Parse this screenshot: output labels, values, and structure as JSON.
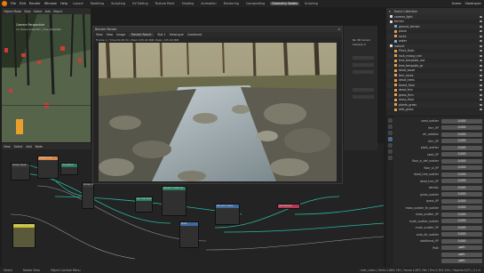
{
  "app": {
    "menus": [
      "File",
      "Edit",
      "Render",
      "Window",
      "Help"
    ],
    "workspaces": [
      "Layout",
      "Modeling",
      "Sculpting",
      "UV Editing",
      "Texture Paint",
      "Shading",
      "Animation",
      "Rendering",
      "Compositing",
      "Geometry Nodes",
      "Scripting"
    ],
    "active_workspace": "Geometry Nodes",
    "scene": "Scene",
    "view_layer": "ViewLayer"
  },
  "viewport": {
    "menu": [
      "Object Mode",
      "View",
      "Select",
      "Add",
      "Object"
    ],
    "view_label": "Camera Perspective",
    "collection_label": "(1) Scene Collection | tree_template"
  },
  "image_editor": {
    "window_title": "Blender Render",
    "menu": [
      "View",
      "View",
      "Image"
    ],
    "image_name": "Render Result",
    "slot": "Slot 1",
    "layer": "ViewLayer",
    "pass": "Combined",
    "info": "Frame:1 | Time:00:28.31 | Mem:225.00 MiB, Peak: 225.00 MiB"
  },
  "node_editor": {
    "menu": [
      "View",
      "Select",
      "Add",
      "Node"
    ],
    "nodes": [
      "Group Input",
      "Object Info",
      "Group Output",
      "Instance on Points",
      "Realize Instances",
      "Math",
      "Random Value",
      "Set Position",
      "Join Geometry",
      "Transform"
    ]
  },
  "side_panel": {
    "items": [
      "No 3D Cursor",
      "Camera Ir"
    ]
  },
  "outliner": {
    "title": "Scene Collection",
    "items": [
      {
        "name": "camera_light",
        "color": "#d9d9d9"
      },
      {
        "name": "terrain",
        "color": "#d9d9d9"
      },
      {
        "name": "ground_terrain",
        "color": "#6fb0e0"
      },
      {
        "name": "plane",
        "color": "#e8a04b"
      },
      {
        "name": "rocks",
        "color": "#e8a04b"
      },
      {
        "name": "water",
        "color": "#6fb0e0"
      },
      {
        "name": "natural",
        "color": "#d9d9d9"
      },
      {
        "name": "Plant_Bush",
        "color": "#e8a04b"
      },
      {
        "name": "rock_mossy_red",
        "color": "#e8a04b"
      },
      {
        "name": "tree_template_red",
        "color": "#e8a04b"
      },
      {
        "name": "tree_template_gr",
        "color": "#e8a04b"
      },
      {
        "name": "dead_wood",
        "color": "#e8a04b"
      },
      {
        "name": "fern_rocks",
        "color": "#e8a04b"
      },
      {
        "name": "dead_trees",
        "color": "#e8a04b"
      },
      {
        "name": "forest_floor",
        "color": "#e8a04b"
      },
      {
        "name": "dead_fern",
        "color": "#e8a04b"
      },
      {
        "name": "grass_firm",
        "color": "#e8a04b"
      },
      {
        "name": "moss_floor",
        "color": "#e8a04b"
      },
      {
        "name": "plants_grass",
        "color": "#e8a04b"
      },
      {
        "name": "wild_grass",
        "color": "#e8a04b"
      }
    ]
  },
  "properties": {
    "rows": [
      {
        "label": "seed_scatter",
        "value": "0.000"
      },
      {
        "label": "fern_VP",
        "value": "0.000"
      },
      {
        "label": "dir_rotation",
        "value": "0.000"
      },
      {
        "label": "fern_VP",
        "value": "0.000"
      },
      {
        "label": "plant_scatter",
        "value": "0.000"
      },
      {
        "label": "seed_VP",
        "value": "0.000"
      },
      {
        "label": "floor_sl_def_scatter",
        "value": "0.000"
      },
      {
        "label": "floor_sl_VP",
        "value": "0.000"
      },
      {
        "label": "dead_tree_scatter",
        "value": "0.000"
      },
      {
        "label": "dead_tree_VP",
        "value": "0.000"
      },
      {
        "label": "density",
        "value": "0.000"
      },
      {
        "label": "grass_scatter",
        "value": "0.000"
      },
      {
        "label": "grass_VP",
        "value": "0.000"
      },
      {
        "label": "moss_scatter_fe_scatter",
        "value": "0.000"
      },
      {
        "label": "moss_scatter_VP",
        "value": "0.000"
      },
      {
        "label": "mush_scatter_scatter",
        "value": "0.000"
      },
      {
        "label": "mush_scatter_VP",
        "value": "0.000"
      },
      {
        "label": "auto_dir_scatter",
        "value": "0.000"
      },
      {
        "label": "additional_VP",
        "value": "0.000"
      },
      {
        "label": "Path",
        "value": "path"
      },
      {
        "label": "",
        "value": "path"
      },
      {
        "label": "",
        "value": "path"
      }
    ]
  },
  "status": {
    "left": [
      "Select",
      "Rotate View",
      "Object Context Menu"
    ],
    "right": "river_rocks | Verts:1,684,745 | Faces:1,653,764 | Tris:3,305,524 | Objects:0/23 | 3.1.0"
  }
}
